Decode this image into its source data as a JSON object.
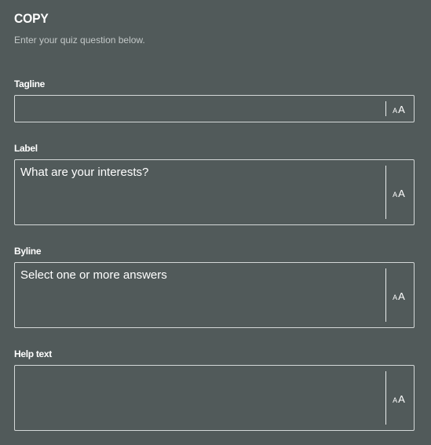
{
  "section": {
    "title": "COPY",
    "description": "Enter your quiz question below."
  },
  "fields": [
    {
      "label": "Tagline",
      "value": "",
      "text_style_icon": "text-size-icon"
    },
    {
      "label": "Label",
      "value": "What are your interests?",
      "text_style_icon": "text-size-icon"
    },
    {
      "label": "Byline",
      "value": "Select one or more answers",
      "text_style_icon": "text-size-icon"
    },
    {
      "label": "Help text",
      "value": "",
      "text_style_icon": "text-size-icon"
    }
  ],
  "colors": {
    "background": "#515a5a",
    "border": "#d4d8d8",
    "text": "#ffffff",
    "muted_text": "#c3c8c8"
  }
}
